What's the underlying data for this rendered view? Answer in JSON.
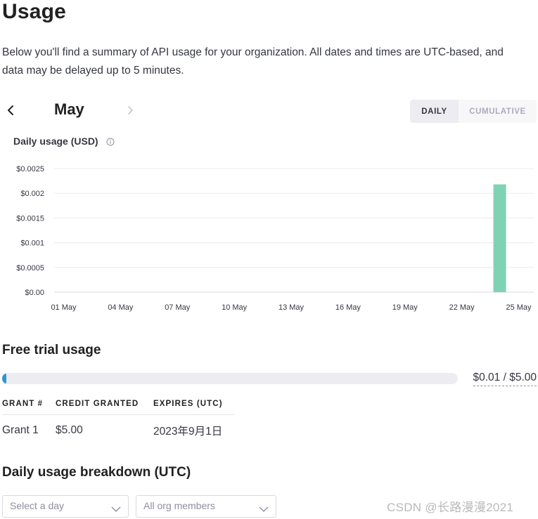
{
  "page": {
    "title": "Usage",
    "intro": "Below you'll find a summary of API usage for your organization. All dates and times are UTC-based, and data may be delayed up to 5 minutes."
  },
  "month_nav": {
    "prev_icon": "chevron-left-icon",
    "next_icon": "chevron-right-icon",
    "month": "May"
  },
  "view_toggle": {
    "daily_label": "DAILY",
    "cumulative_label": "CUMULATIVE",
    "selected": "DAILY"
  },
  "chart_title": "Daily usage (USD)",
  "chart_data": {
    "type": "bar",
    "title": "Daily usage (USD)",
    "xlabel": "",
    "ylabel": "",
    "x_ticks": [
      "01 May",
      "04 May",
      "07 May",
      "10 May",
      "13 May",
      "16 May",
      "19 May",
      "22 May",
      "25 May"
    ],
    "y_ticks": [
      "$0.00",
      "$0.0005",
      "$0.001",
      "$0.0015",
      "$0.002",
      "$0.0025"
    ],
    "ylim": [
      0,
      0.0025
    ],
    "days": [
      1,
      2,
      3,
      4,
      5,
      6,
      7,
      8,
      9,
      10,
      11,
      12,
      13,
      14,
      15,
      16,
      17,
      18,
      19,
      20,
      21,
      22,
      23,
      24,
      25
    ],
    "values": [
      0,
      0,
      0,
      0,
      0,
      0,
      0,
      0,
      0,
      0,
      0,
      0,
      0,
      0,
      0,
      0,
      0,
      0,
      0,
      0,
      0,
      0,
      0,
      0.00218,
      0
    ],
    "bar_color": "#7fd3b4",
    "grid": true,
    "legend": "none"
  },
  "free_trial": {
    "title": "Free trial usage",
    "used_fraction": 0.002,
    "amount_label": "$0.01 / $5.00",
    "bar_color": "#2e95d3"
  },
  "grants": {
    "headers": [
      "GRANT #",
      "CREDIT GRANTED",
      "EXPIRES (UTC)"
    ],
    "rows": [
      [
        "Grant 1",
        "$5.00",
        "2023年9月1日"
      ]
    ]
  },
  "breakdown": {
    "title": "Daily usage breakdown (UTC)",
    "day_select_placeholder": "Select a day",
    "members_select_value": "All org members"
  },
  "watermark": "CSDN @长路漫漫2021"
}
